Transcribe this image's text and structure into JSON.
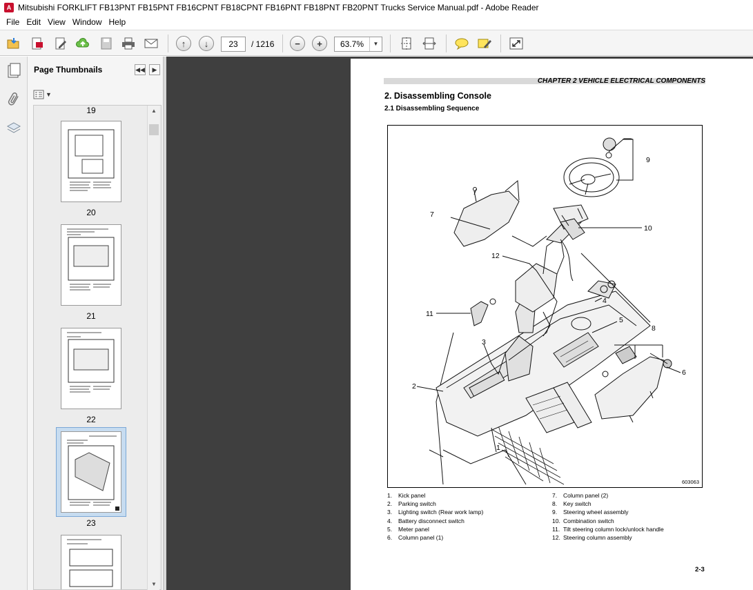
{
  "window": {
    "title": "Mitsubishi FORKLIFT FB13PNT FB15PNT FB16CPNT FB18CPNT FB16PNT FB18PNT FB20PNT Trucks Service Manual.pdf - Adobe Reader",
    "app_icon": "adobe-reader-icon"
  },
  "menu": [
    "File",
    "Edit",
    "View",
    "Window",
    "Help"
  ],
  "toolbar": {
    "page_current": "23",
    "page_total": "/ 1216",
    "zoom_value": "63.7%",
    "icons": [
      "open-icon",
      "create-pdf-icon",
      "edit-icon",
      "upload-icon",
      "save-icon",
      "print-icon",
      "email-icon",
      "previous-page-icon",
      "next-page-icon",
      "zoom-out-icon",
      "zoom-in-icon",
      "fit-page-icon",
      "fit-width-icon",
      "comment-icon",
      "highlight-icon",
      "fullscreen-icon"
    ]
  },
  "nav_panel": {
    "icons": [
      "pages-icon",
      "attachments-icon",
      "layers-icon"
    ]
  },
  "thumbnails": {
    "title": "Page Thumbnails",
    "pages": [
      {
        "label": "19",
        "selected": false
      },
      {
        "label": "20",
        "selected": false
      },
      {
        "label": "21",
        "selected": false
      },
      {
        "label": "22",
        "selected": false
      },
      {
        "label": "23",
        "selected": true
      }
    ]
  },
  "page": {
    "chapter_header": "CHAPTER 2 VEHICLE ELECTRICAL COMPONENTS",
    "heading": "2.    Disassembling Console",
    "subheading": "2.1       Disassembling Sequence",
    "figure_code": "603063",
    "callouts": [
      "1",
      "2",
      "3",
      "4",
      "5",
      "6",
      "7",
      "8",
      "9",
      "10",
      "11",
      "12"
    ],
    "legend_left": [
      {
        "num": "1.",
        "text": "Kick panel"
      },
      {
        "num": "2.",
        "text": "Parking switch"
      },
      {
        "num": "3.",
        "text": "Lighting switch (Rear work lamp)"
      },
      {
        "num": "4.",
        "text": "Battery disconnect switch"
      },
      {
        "num": "5.",
        "text": "Meter panel"
      },
      {
        "num": "6.",
        "text": "Column panel (1)"
      }
    ],
    "legend_right": [
      {
        "num": "7.",
        "text": "Column panel (2)"
      },
      {
        "num": "8.",
        "text": "Key switch"
      },
      {
        "num": "9.",
        "text": "Steering wheel assembly"
      },
      {
        "num": "10.",
        "text": "Combination switch"
      },
      {
        "num": "11.",
        "text": "Tilt steering column lock/unlock handle"
      },
      {
        "num": "12.",
        "text": "Steering column assembly"
      }
    ],
    "page_number": "2-3"
  }
}
